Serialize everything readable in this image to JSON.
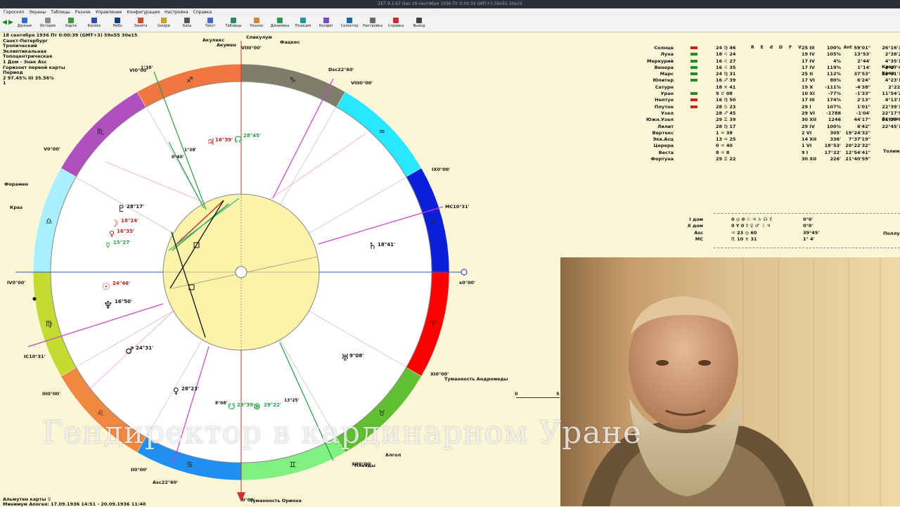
{
  "window_title": "ZET 9.3.67 Geo 18 сентября 1936 Пт 0:00:39 GMT+3 59n55 30e15",
  "menu": [
    "Гороскоп",
    "Экраны",
    "Таблицы",
    "Разное",
    "Управление",
    "Конфигурация",
    "Настройка",
    "Справка"
  ],
  "toolbar": [
    {
      "label": "Данные",
      "color": "#2a6fd6"
    },
    {
      "label": "История",
      "color": "#8a8a8a"
    },
    {
      "label": "Карта",
      "color": "#3a9a3a"
    },
    {
      "label": "Космос",
      "color": "#2a4fb0"
    },
    {
      "label": "Небо",
      "color": "#0a3a8a"
    },
    {
      "label": "Зенита",
      "color": "#d04a2a"
    },
    {
      "label": "Google",
      "color": "#c8a020"
    },
    {
      "label": "База",
      "color": "#555555"
    },
    {
      "label": "Текст",
      "color": "#3a6ad0"
    },
    {
      "label": "Таблицы",
      "color": "#2a8a6a"
    },
    {
      "label": "Разное",
      "color": "#d08a2a"
    },
    {
      "label": "Динамика",
      "color": "#2a9a4a"
    },
    {
      "label": "Позиция",
      "color": "#1a9a9a"
    },
    {
      "label": "Конфиг",
      "color": "#7a4ad0"
    },
    {
      "label": "Селектор",
      "color": "#1a6ab0"
    },
    {
      "label": "Настройка",
      "color": "#6a6a6a"
    },
    {
      "label": "Справка",
      "color": "#d02a2a"
    },
    {
      "label": "Выход",
      "color": "#444444"
    }
  ],
  "info": {
    "date": "18 сентября 1936  Пт    0:00:39 (GMT+3)  59n55  30e15",
    "city": "Санкт-Петербург",
    "l1": "Тропический",
    "l2": "Эклиптикальная",
    "l3": "Топоцентрическая",
    "l4": "1 Дом - Знак Asc",
    "l5": "Горизонт первой карты",
    "l6": "Период",
    "l7": "2 97.45% III  35.56%",
    "l8": "1"
  },
  "wheel_labels": {
    "mc": "MC",
    "mc_deg": "10°31'",
    "asc": "Asc",
    "asc_deg": "22°60'",
    "dsc": "Dsc",
    "dsc_deg": "22°60'",
    "ic": "IC",
    "ic_deg": "10°31'",
    "vii": "VII",
    "vii_deg": "0°00'",
    "x_deg": "0°00'",
    "ix_deg": "0°00'",
    "xi_deg": "0°00'",
    "iv_deg": "0°00'",
    "iii_deg": "0°00'",
    "ii_deg": "0°00'",
    "v_deg": "0°00'",
    "vi_deg": "0°00'",
    "viii_deg": "0°00'",
    "xii_deg": "0°00'",
    "i_deg": "0°00'"
  },
  "planets_chart": [
    {
      "glyph": "♄",
      "deg": "18°41'"
    },
    {
      "glyph": "♃",
      "deg": "16°39'"
    },
    {
      "glyph": "☊",
      "deg": "28°45'"
    },
    {
      "glyph": "♇",
      "deg": "28°17'"
    },
    {
      "glyph": "☽",
      "deg": "18°24'"
    },
    {
      "glyph": "♀",
      "deg": "16°35'"
    },
    {
      "glyph": "☿",
      "deg": "15°27'"
    },
    {
      "glyph": "☉",
      "deg": "24°46'"
    },
    {
      "glyph": "♆",
      "deg": "16°50'"
    },
    {
      "glyph": "♂",
      "deg": "24°31'"
    },
    {
      "glyph": "♀",
      "deg": "28°23'"
    },
    {
      "glyph": "☋",
      "deg": "29°39'"
    },
    {
      "glyph": "⊗",
      "deg": "29°22'"
    },
    {
      "glyph": "♅",
      "deg": "9°08'"
    }
  ],
  "stars": {
    "s1": "Акулекс",
    "s2": "Акумен",
    "s3": "Спикулум",
    "s4": "Фацкес",
    "s5": "Форамен",
    "s6": "Краз",
    "s7": "Туманность Андромеды",
    "s8": "Туманность Ориона",
    "s9": "Плеяды",
    "s10": "Алгол"
  },
  "table": {
    "headers": [
      "R",
      "E",
      "d",
      "D",
      "F",
      "V",
      "Ant"
    ],
    "rows": [
      {
        "name": "Солнце",
        "pos": "24 ♍ 46",
        "d": "25 III",
        "pct": "100%",
        "v": "59'01\"",
        "ant": "26°16'39\""
      },
      {
        "name": "Луна",
        "pos": "18 ♌ 24",
        "d": "19 IV",
        "pct": "105%",
        "v": "13°53'",
        "ant": "2°38'21\""
      },
      {
        "name": "Меркурий",
        "pos": "16 ♌ 27",
        "d": "17 IV",
        "pct": "4%",
        "v": "2°44'",
        "ant": "4°35'17\""
      },
      {
        "name": "Венера",
        "pos": "16 ♌ 35",
        "d": "17 IV",
        "pct": "119%",
        "v": "1°14'",
        "ant": "4°27'41\""
      },
      {
        "name": "Марс",
        "pos": "24 ♍ 31",
        "d": "25 II",
        "pct": "112%",
        "v": "37'53\"",
        "ant": "26°31'19\""
      },
      {
        "name": "Юпитер",
        "pos": "16 ♐ 39",
        "d": "17 VI",
        "pct": "80%",
        "v": "6'24\"",
        "ant": "4°23'19\""
      },
      {
        "name": "Сатурн",
        "pos": "18 ♓ 41",
        "d": "19 X",
        "pct": "-111%",
        "v": "-4'38\"",
        "ant": "2°22'5\""
      },
      {
        "name": "Уран",
        "pos": "9 ♉ 08",
        "d": "10 XI",
        "pct": "-77%",
        "v": "-1'33\"",
        "ant": "11°54'23\""
      },
      {
        "name": "Нептун",
        "pos": "16 ♍ 50",
        "d": "17 III",
        "pct": "174%",
        "v": "2'13\"",
        "ant": "4°13'10\""
      },
      {
        "name": "Плутон",
        "pos": "28 ♋ 23",
        "d": "29 I",
        "pct": "107%",
        "v": "1'01\"",
        "ant": "22°39'18\""
      },
      {
        "name": "Узел",
        "pos": "28 ♐ 45",
        "d": "29 VI",
        "pct": "-1788",
        "v": "-1'04'",
        "ant": "22°17'58\""
      },
      {
        "name": "Южн.Узел",
        "pos": "29 ♊ 39",
        "d": "30 XII",
        "pct": "1246",
        "v": "44'17\"",
        "ant": "21°23'52\""
      },
      {
        "name": "Лилит",
        "pos": "28 ♍ 17",
        "d": "29 IV",
        "pct": "100%",
        "v": "6'42\"",
        "ant": "22°45'16\""
      },
      {
        "name": "Вертекс",
        "pos": "1 ♒ 38",
        "d": "2 VI",
        "pct": "305'",
        "v": "19°24'32\"",
        "ant": ""
      },
      {
        "name": "Экв.Асц",
        "pos": "13 ♒ 25",
        "d": "14 XII",
        "pct": "336'",
        "v": "7°37'19\"",
        "ant": ""
      },
      {
        "name": "Церера",
        "pos": "0 ♒ 40",
        "d": "1 VI",
        "pct": "18°53'",
        "v": "20°22'32\"",
        "ant": ""
      },
      {
        "name": "Веста",
        "pos": "8 ♒ 8",
        "d": "9 I",
        "pct": "17°22'",
        "v": "12°54'41\"",
        "ant": ""
      },
      {
        "name": "Фортуна",
        "pos": "29 ♊ 22",
        "d": "30 XII",
        "pct": "226'",
        "v": "21°40'59\"",
        "ant": ""
      }
    ],
    "right_labels": {
      "r1": "Краз",
      "r2": "Краз",
      "r3": "Акумен",
      "r4": "Толима",
      "r5": "Поллукс"
    }
  },
  "aspects_table": [
    {
      "name": "I дом",
      "vals": "0 ◎ 0   ☉ ♃ ♄ ☊ ♇",
      "deg": "0°0'"
    },
    {
      "name": "X дом",
      "vals": "0 Y 0   ☿ ♀ ♂ ☽ ♃",
      "deg": "0°0'"
    },
    {
      "name": "Asc",
      "vals": "♒ 23 ◎ 60",
      "deg": "39°45'"
    },
    {
      "name": "MC",
      "vals": "♏ 10 ♓ 31",
      "deg": "1° 4'"
    }
  ],
  "mini_scale": {
    "start": "0",
    "end": "5"
  },
  "caption": "Гендиректор в кардинарном Уране",
  "bottom": {
    "line1": "Альмутен карты ♀",
    "line2": "Минимум Апогея: 17.09.1936 14:51 - 20.09.1936 11:40"
  }
}
